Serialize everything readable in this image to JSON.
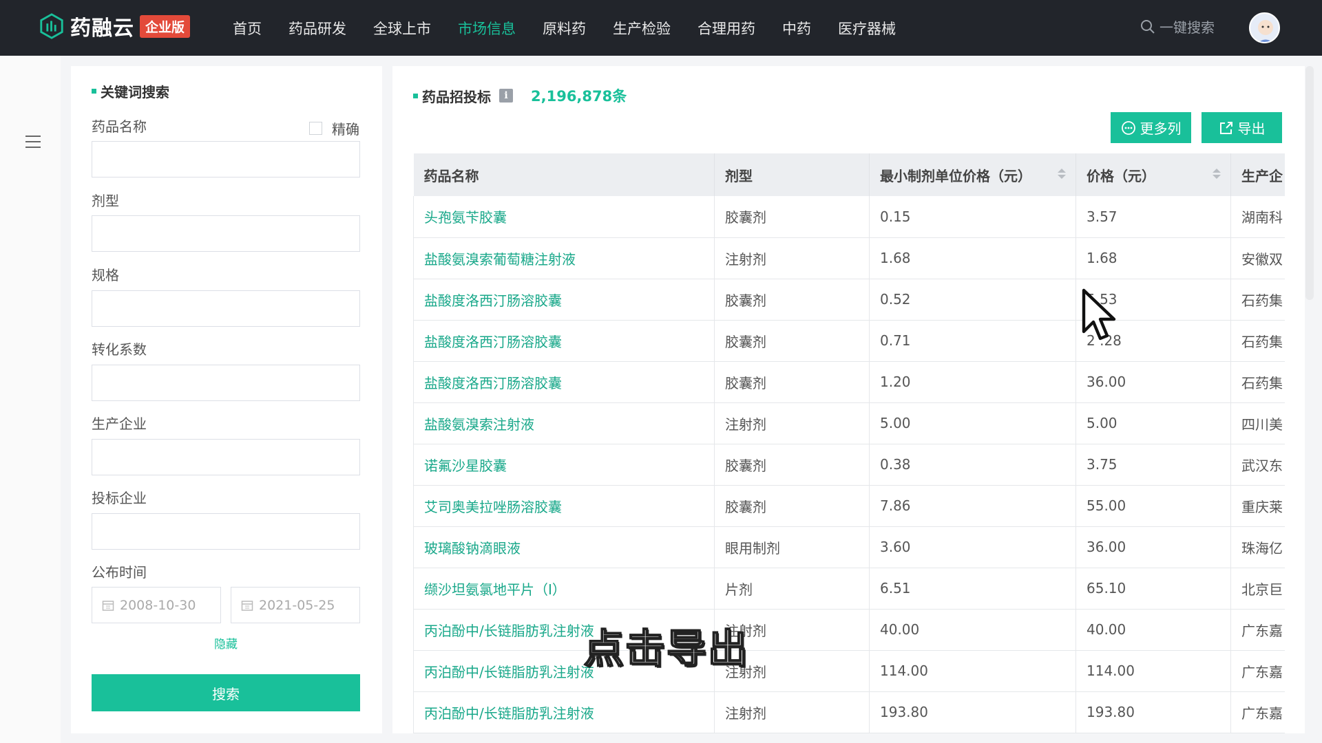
{
  "app": {
    "logo_text": "药融云",
    "logo_badge": "企业版",
    "colors": {
      "accent": "#19c09a",
      "nav_bg": "#22252b",
      "badge": "#e34a3a"
    }
  },
  "nav": {
    "items": [
      "首页",
      "药品研发",
      "全球上市",
      "市场信息",
      "原料药",
      "生产检验",
      "合理用药",
      "中药",
      "医疗器械"
    ],
    "active": "市场信息",
    "search_label": "一键搜索"
  },
  "filter": {
    "title": "关键词搜索",
    "drug_name_label": "药品名称",
    "exact_label": "精确",
    "dosage_form_label": "剂型",
    "spec_label": "规格",
    "conversion_label": "转化系数",
    "manufacturer_label": "生产企业",
    "bidder_label": "投标企业",
    "publish_time_label": "公布时间",
    "date_start": "2008-10-30",
    "date_end": "2021-05-25",
    "hide_label": "隐藏",
    "search_button": "搜索"
  },
  "main": {
    "title": "药品招投标",
    "info_icon": "i",
    "count": "2,196,878条",
    "more_columns_button": "更多列",
    "export_button": "导出",
    "columns": [
      "药品名称",
      "剂型",
      "最小制剂单位价格（元）",
      "价格（元）",
      "生产企"
    ],
    "rows": [
      [
        "头孢氨苄胶囊",
        "胶囊剂",
        "0.15",
        "3.57",
        "湖南科"
      ],
      [
        "盐酸氨溴索葡萄糖注射液",
        "注射剂",
        "1.68",
        "1.68",
        "安徽双"
      ],
      [
        "盐酸度洛西汀肠溶胶囊",
        "胶囊剂",
        "0.52",
        "5.53",
        "石药集"
      ],
      [
        "盐酸度洛西汀肠溶胶囊",
        "胶囊剂",
        "0.71",
        "2 .28",
        "石药集"
      ],
      [
        "盐酸度洛西汀肠溶胶囊",
        "胶囊剂",
        "1.20",
        "36.00",
        "石药集"
      ],
      [
        "盐酸氨溴索注射液",
        "注射剂",
        "5.00",
        "5.00",
        "四川美"
      ],
      [
        "诺氟沙星胶囊",
        "胶囊剂",
        "0.38",
        "3.75",
        "武汉东"
      ],
      [
        "艾司奥美拉唑肠溶胶囊",
        "胶囊剂",
        "7.86",
        "55.00",
        "重庆莱"
      ],
      [
        "玻璃酸钠滴眼液",
        "眼用制剂",
        "3.60",
        "36.00",
        "珠海亿"
      ],
      [
        "缬沙坦氨氯地平片（I）",
        "片剂",
        "6.51",
        "65.10",
        "北京巨"
      ],
      [
        "丙泊酚中/长链脂肪乳注射液",
        "注射剂",
        "40.00",
        "40.00",
        "广东嘉"
      ],
      [
        "丙泊酚中/长链脂肪乳注射液",
        "注射剂",
        "114.00",
        "114.00",
        "广东嘉"
      ],
      [
        "丙泊酚中/长链脂肪乳注射液",
        "注射剂",
        "193.80",
        "193.80",
        "广东嘉"
      ]
    ]
  },
  "overlay": {
    "caption": "点击导出"
  }
}
